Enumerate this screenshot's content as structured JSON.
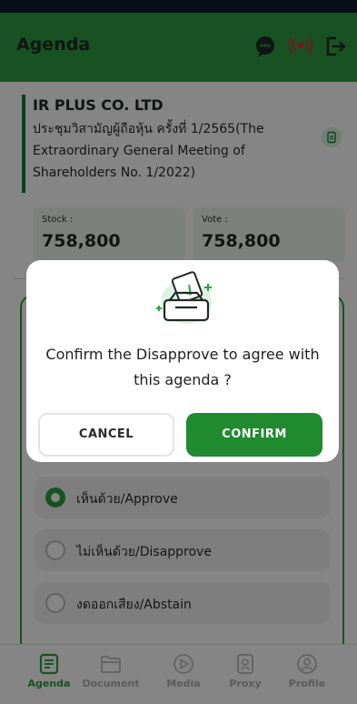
{
  "header": {
    "title": "Agenda"
  },
  "company": {
    "name": "IR PLUS CO. LTD",
    "meeting": "ประชุมวิสามัญผู้ถือหุ้น ครั้งที่ 1/2565(The Extraordinary General Meeting of Shareholders No. 1/2022)"
  },
  "stats": {
    "stock_label": "Stock :",
    "stock_value": "758,800",
    "vote_label": "Vote :",
    "vote_value": "758,800"
  },
  "options": [
    {
      "label": "เห็นด้วย/Approve",
      "selected": true
    },
    {
      "label": "ไม่เห็นด้วย/Disapprove",
      "selected": false
    },
    {
      "label": "งดออกเสียง/Abstain",
      "selected": false
    }
  ],
  "nav": [
    {
      "label": "Agenda",
      "icon": "agenda-icon",
      "active": true
    },
    {
      "label": "Document",
      "icon": "document-icon",
      "active": false
    },
    {
      "label": "Media",
      "icon": "media-icon",
      "active": false
    },
    {
      "label": "Proxy",
      "icon": "proxy-icon",
      "active": false
    },
    {
      "label": "Profile",
      "icon": "profile-icon",
      "active": false
    }
  ],
  "dialog": {
    "message": "Confirm the  Disapprove to agree with this agenda ?",
    "cancel_label": "CANCEL",
    "confirm_label": "CONFIRM"
  },
  "colors": {
    "brand": "#2f9e44",
    "confirm": "#1f8a2e",
    "live": "#e03131"
  }
}
